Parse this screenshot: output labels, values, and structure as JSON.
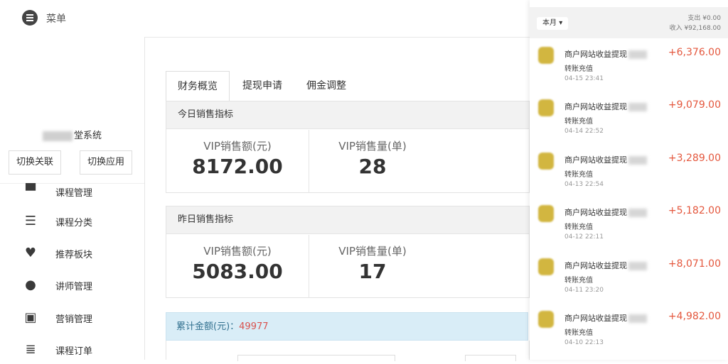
{
  "header": {
    "menu_label": "菜单"
  },
  "sidebar": {
    "system_name": "堂系统",
    "buttons": [
      "切换关联",
      "切换应用"
    ],
    "items": [
      {
        "label": "课程管理",
        "icon": "graduation-cap-icon"
      },
      {
        "label": "课程分类",
        "icon": "list-icon"
      },
      {
        "label": "推荐板块",
        "icon": "heart-icon"
      },
      {
        "label": "讲师管理",
        "icon": "user-icon"
      },
      {
        "label": "营销管理",
        "icon": "gift-icon"
      },
      {
        "label": "课程订单",
        "icon": "ordered-list-icon"
      }
    ]
  },
  "tabs": [
    "财务概览",
    "提现申请",
    "佣金调整"
  ],
  "today": {
    "title": "今日销售指标",
    "sales_label": "VIP销售额(元)",
    "sales_value": "8172.00",
    "count_label": "VIP销售量(单)",
    "count_value": "28"
  },
  "yesterday": {
    "title": "昨日销售指标",
    "sales_label": "VIP销售额(元)",
    "sales_value": "5083.00",
    "count_label": "VIP销售量(单)",
    "count_value": "17"
  },
  "total": {
    "label": "累计金额(元)：",
    "value": "49977"
  },
  "phone": {
    "period": "本月",
    "expense": "支出 ¥0.00",
    "income": "收入 ¥92,168.00",
    "transactions": [
      {
        "title": "商户网站收益提现",
        "sub": "转账充值",
        "date": "04-15  23:41",
        "amount": "+6,376.00"
      },
      {
        "title": "商户网站收益提现",
        "sub": "转账充值",
        "date": "04-14  22:52",
        "amount": "+9,079.00"
      },
      {
        "title": "商户网站收益提现",
        "sub": "转账充值",
        "date": "04-13  22:54",
        "amount": "+3,289.00"
      },
      {
        "title": "商户网站收益提现",
        "sub": "转账充值",
        "date": "04-12  22:11",
        "amount": "+5,182.00"
      },
      {
        "title": "商户网站收益提现",
        "sub": "转账充值",
        "date": "04-11  23:20",
        "amount": "+8,071.00"
      },
      {
        "title": "商户网站收益提现",
        "sub": "转账充值",
        "date": "04-10  22:13",
        "amount": "+4,982.00"
      }
    ]
  },
  "colors": {
    "accent_red": "#e4573d",
    "info_bg": "#d9edf7",
    "header_bg": "#f2f2f2"
  }
}
